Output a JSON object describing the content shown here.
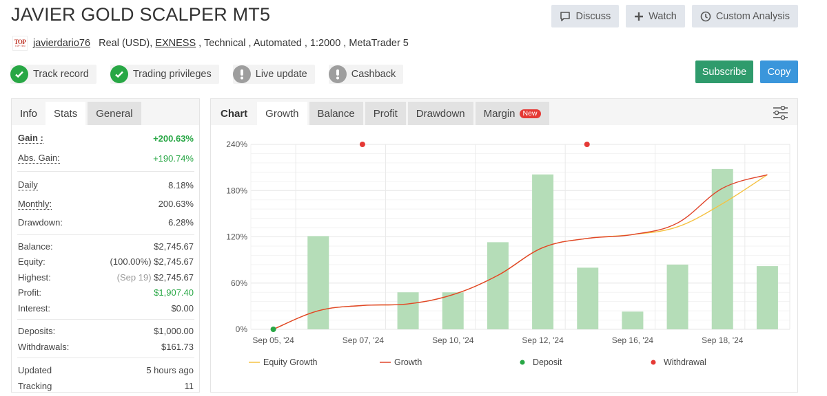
{
  "header": {
    "title": "JAVIER GOLD SCALPER MT5",
    "actions": [
      {
        "label": "Discuss",
        "icon": "comment-icon"
      },
      {
        "label": "Watch",
        "icon": "plus-icon"
      },
      {
        "label": "Custom Analysis",
        "icon": "clock-icon"
      }
    ]
  },
  "meta": {
    "logo_text": "TOP",
    "logo_subtext": "TOP TEN",
    "username": "javierdario76",
    "account_type": "Real (USD), ",
    "broker": "EXNESS",
    "rest": " , Technical , Automated , 1:2000 , MetaTrader 5"
  },
  "badges": [
    {
      "label": "Track record",
      "status": "ok"
    },
    {
      "label": "Trading privileges",
      "status": "ok"
    },
    {
      "label": "Live update",
      "status": "warn"
    },
    {
      "label": "Cashback",
      "status": "warn"
    }
  ],
  "buttons": {
    "subscribe": "Subscribe",
    "copy": "Copy"
  },
  "left_panel": {
    "tabs": {
      "info": "Info",
      "stats": "Stats",
      "general": "General"
    },
    "gain": {
      "label": "Gain :",
      "value": "+200.63%"
    },
    "abs_gain": {
      "label": "Abs. Gain:",
      "value": "+190.74%"
    },
    "daily": {
      "label": "Daily",
      "value": "8.18%"
    },
    "monthly": {
      "label": "Monthly:",
      "value": "200.63%"
    },
    "drawdown": {
      "label": "Drawdown:",
      "value": "6.28%"
    },
    "balance": {
      "label": "Balance:",
      "value": "$2,745.67"
    },
    "equity": {
      "label": "Equity:",
      "prefix": "(100.00%)",
      "value": "$2,745.67"
    },
    "highest": {
      "label": "Highest:",
      "prefix": "(Sep 19)",
      "value": "$2,745.67"
    },
    "profit": {
      "label": "Profit:",
      "value": "$1,907.40"
    },
    "interest": {
      "label": "Interest:",
      "value": "$0.00"
    },
    "deposits": {
      "label": "Deposits:",
      "value": "$1,000.00"
    },
    "withdrawals": {
      "label": "Withdrawals:",
      "value": "$161.73"
    },
    "updated": {
      "label": "Updated",
      "value": "5 hours ago"
    },
    "tracking": {
      "label": "Tracking",
      "value": "11"
    }
  },
  "chart_panel": {
    "tabs": {
      "chart": "Chart",
      "growth": "Growth",
      "balance": "Balance",
      "profit": "Profit",
      "drawdown": "Drawdown",
      "margin": "Margin",
      "margin_badge": "New"
    }
  },
  "chart_data": {
    "type": "bar",
    "title": "Growth",
    "xlabel": "",
    "ylabel": "",
    "ylim": [
      0,
      240
    ],
    "yticks": [
      "0%",
      "60%",
      "120%",
      "180%",
      "240%"
    ],
    "ytick_values": [
      0,
      60,
      120,
      180,
      240
    ],
    "grid": true,
    "x_positions": [
      0,
      1,
      2,
      3,
      4,
      5,
      6,
      7,
      8,
      9,
      10,
      11
    ],
    "x_tick_labels": [
      {
        "pos": 0,
        "label": "Sep 05, '24"
      },
      {
        "pos": 2,
        "label": "Sep 07, '24"
      },
      {
        "pos": 4,
        "label": "Sep 10, '24"
      },
      {
        "pos": 6,
        "label": "Sep 12, '24"
      },
      {
        "pos": 8,
        "label": "Sep 16, '24"
      },
      {
        "pos": 10,
        "label": "Sep 18, '24"
      }
    ],
    "x_range": [
      -0.5,
      11.5
    ],
    "bars": {
      "name": "Daily Profit",
      "color": "#b5ddb8",
      "values": [
        {
          "x": 1,
          "y": 121
        },
        {
          "x": 3,
          "y": 48
        },
        {
          "x": 4,
          "y": 48
        },
        {
          "x": 5,
          "y": 113
        },
        {
          "x": 6,
          "y": 201
        },
        {
          "x": 7,
          "y": 80
        },
        {
          "x": 8,
          "y": 23
        },
        {
          "x": 9,
          "y": 84
        },
        {
          "x": 10,
          "y": 208
        },
        {
          "x": 11,
          "y": 82
        }
      ]
    },
    "series": [
      {
        "name": "Equity Growth",
        "color": "#f5c242",
        "x": [
          0,
          1,
          2,
          3,
          4,
          5,
          6,
          7,
          8,
          9,
          10,
          11
        ],
        "values": [
          0,
          24,
          31,
          33,
          45,
          70,
          106,
          118,
          123,
          133,
          163,
          200.6
        ]
      },
      {
        "name": "Growth",
        "color": "#e0452b",
        "x": [
          0,
          1,
          2,
          3,
          4,
          5,
          6,
          7,
          8,
          9,
          10,
          11
        ],
        "values": [
          0,
          24,
          31,
          33,
          45,
          70,
          106,
          118,
          123,
          138,
          183,
          200.6
        ]
      }
    ],
    "deposits": [
      {
        "x": 0,
        "y": 0
      }
    ],
    "withdrawals": [
      {
        "x": 2,
        "y": 240
      },
      {
        "x": 7,
        "y": 240
      }
    ],
    "legend": {
      "position": "bottom",
      "items": [
        {
          "label": "Equity Growth",
          "type": "line",
          "color": "#f5c242"
        },
        {
          "label": "Growth",
          "type": "line",
          "color": "#e0452b"
        },
        {
          "label": "Deposit",
          "type": "dot",
          "color": "#28a745"
        },
        {
          "label": "Withdrawal",
          "type": "dot",
          "color": "#e53935"
        }
      ]
    }
  }
}
